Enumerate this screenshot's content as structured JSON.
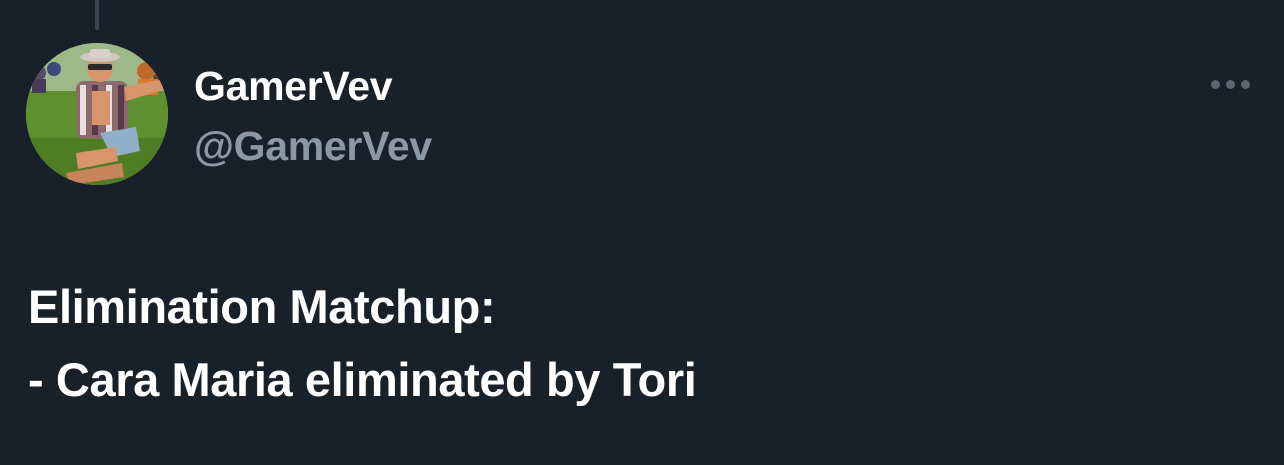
{
  "tweet": {
    "author": {
      "display_name": "GamerVev",
      "handle": "@GamerVev",
      "avatar": "profile-photo"
    },
    "more_icon": "more-horizontal-icon",
    "text_lines": [
      "Elimination Matchup:",
      "- Cara Maria eliminated by Tori"
    ]
  },
  "colors": {
    "background": "#18202a",
    "primary_text": "#ffffff",
    "secondary_text": "#8b98a5",
    "icon_gray": "#5b6670"
  }
}
